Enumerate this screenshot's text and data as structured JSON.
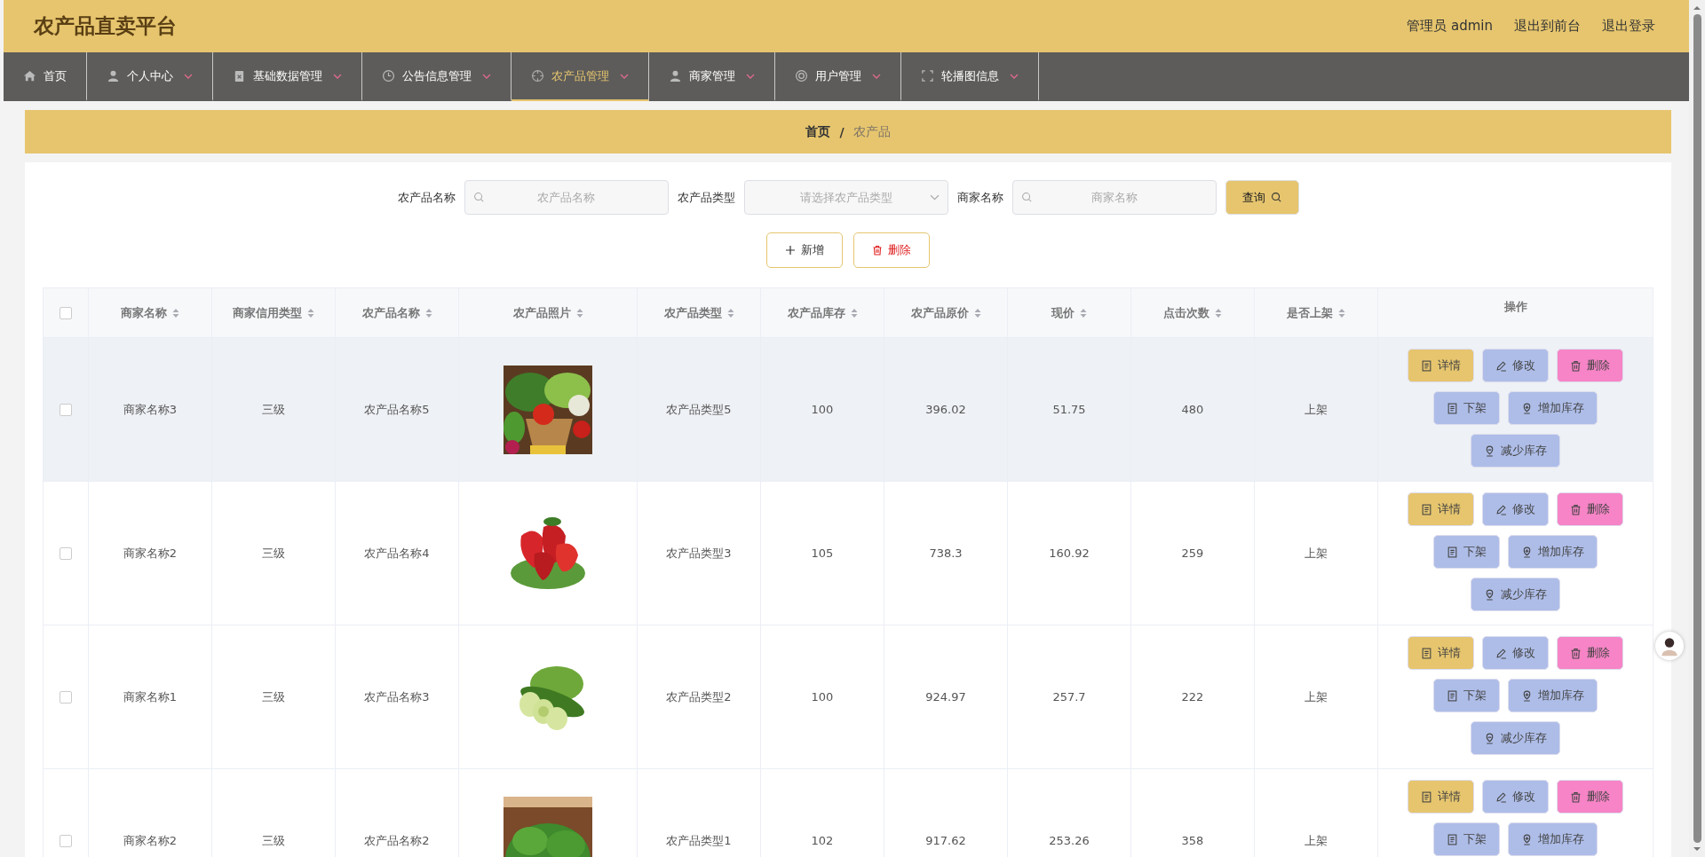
{
  "header": {
    "title": "农产品直卖平台",
    "links": [
      "管理员 admin",
      "退出到前台",
      "退出登录"
    ]
  },
  "nav": [
    {
      "label": "首页",
      "has_menu": false,
      "selected": false
    },
    {
      "label": "个人中心",
      "has_menu": true,
      "selected": false
    },
    {
      "label": "基础数据管理",
      "has_menu": true,
      "selected": false
    },
    {
      "label": "公告信息管理",
      "has_menu": true,
      "selected": false
    },
    {
      "label": "农产品管理",
      "has_menu": true,
      "selected": true
    },
    {
      "label": "商家管理",
      "has_menu": true,
      "selected": false
    },
    {
      "label": "用户管理",
      "has_menu": true,
      "selected": false
    },
    {
      "label": "轮播图信息",
      "has_menu": true,
      "selected": false
    }
  ],
  "breadcrumb": {
    "items": [
      "首页",
      "农产品"
    ],
    "separator": "/"
  },
  "search": {
    "fields": [
      {
        "label": "农产品名称",
        "placeholder": "农产品名称",
        "kind": "text"
      },
      {
        "label": "农产品类型",
        "placeholder": "请选择农产品类型",
        "kind": "select"
      },
      {
        "label": "商家名称",
        "placeholder": "商家名称",
        "kind": "text"
      }
    ],
    "button": "查询"
  },
  "actions": [
    {
      "label": "新增",
      "kind": "add"
    },
    {
      "label": "删除",
      "kind": "delete"
    }
  ],
  "table": {
    "select_all": {
      "checked": false
    },
    "columns": [
      "商家名称",
      "商家信用类型",
      "农产品名称",
      "农产品照片",
      "农产品类型",
      "农产品库存",
      "农产品原价",
      "现价",
      "点击次数",
      "是否上架",
      "操作"
    ],
    "rows": [
      {
        "checked": false,
        "highlighted": true,
        "cells": [
          "商家名称3",
          "三级",
          "农产品名称5",
          "",
          "农产品类型5",
          "100",
          "396.02",
          "51.75",
          "480",
          "上架"
        ],
        "buttons": [
          {
            "label": "详情",
            "kind": "detail"
          },
          {
            "label": "修改",
            "kind": "edit"
          },
          {
            "label": "删除",
            "kind": "delete"
          },
          {
            "label": "下架",
            "kind": "shelf"
          },
          {
            "label": "增加库存",
            "kind": "add-stock"
          },
          {
            "label": "减少库存",
            "kind": "reduce-stock"
          }
        ]
      },
      {
        "checked": false,
        "highlighted": false,
        "cells": [
          "商家名称2",
          "三级",
          "农产品名称4",
          "",
          "农产品类型3",
          "105",
          "738.3",
          "160.92",
          "259",
          "上架"
        ],
        "buttons": [
          {
            "label": "详情",
            "kind": "detail"
          },
          {
            "label": "修改",
            "kind": "edit"
          },
          {
            "label": "删除",
            "kind": "delete"
          },
          {
            "label": "下架",
            "kind": "shelf"
          },
          {
            "label": "增加库存",
            "kind": "add-stock"
          },
          {
            "label": "减少库存",
            "kind": "reduce-stock"
          }
        ]
      },
      {
        "checked": false,
        "highlighted": false,
        "cells": [
          "商家名称1",
          "三级",
          "农产品名称3",
          "",
          "农产品类型2",
          "100",
          "924.97",
          "257.7",
          "222",
          "上架"
        ],
        "buttons": [
          {
            "label": "详情",
            "kind": "detail"
          },
          {
            "label": "修改",
            "kind": "edit"
          },
          {
            "label": "删除",
            "kind": "delete"
          },
          {
            "label": "下架",
            "kind": "shelf"
          },
          {
            "label": "增加库存",
            "kind": "add-stock"
          },
          {
            "label": "减少库存",
            "kind": "reduce-stock"
          }
        ]
      },
      {
        "checked": false,
        "highlighted": false,
        "cells": [
          "商家名称2",
          "三级",
          "农产品名称2",
          "",
          "农产品类型1",
          "102",
          "917.62",
          "253.26",
          "358",
          "上架"
        ],
        "buttons": [
          {
            "label": "详情",
            "kind": "detail"
          },
          {
            "label": "修改",
            "kind": "edit"
          },
          {
            "label": "删除",
            "kind": "delete"
          },
          {
            "label": "下架",
            "kind": "shelf"
          },
          {
            "label": "增加库存",
            "kind": "add-stock"
          }
        ]
      }
    ]
  }
}
